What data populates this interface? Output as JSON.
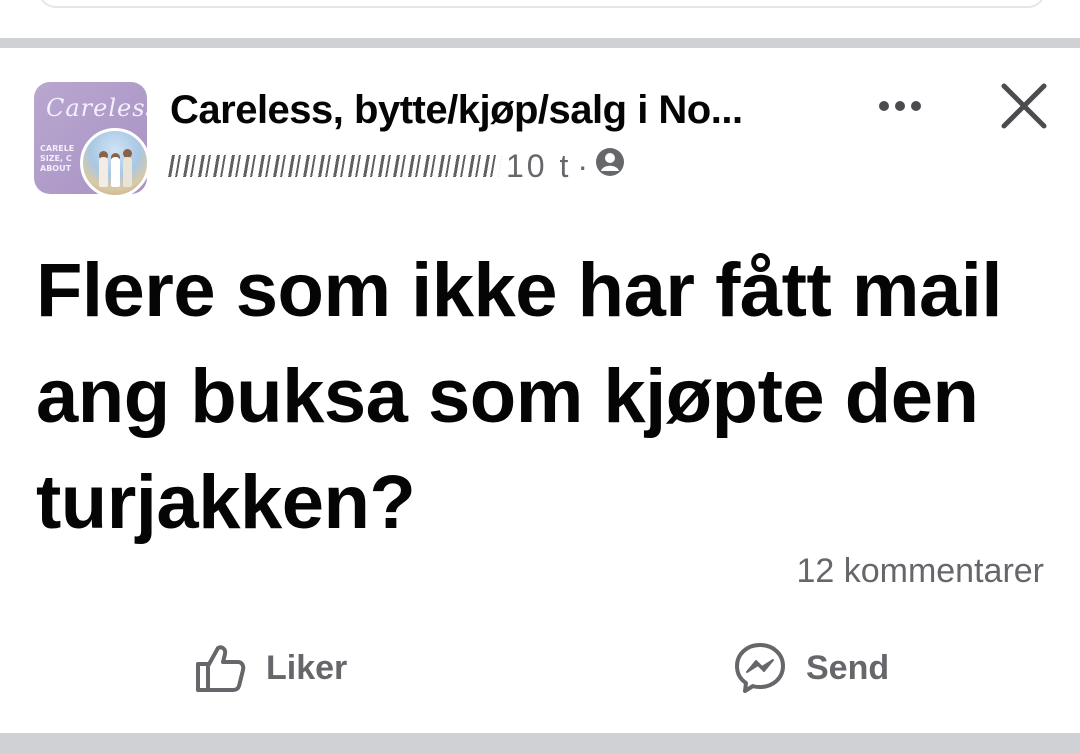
{
  "post": {
    "group_name": "Careless, bytte/kjøp/salg i No...",
    "group_avatar_script": "Careless",
    "group_avatar_lines": [
      "CARELE",
      "SIZE, C",
      "ABOUT"
    ],
    "time": "10 t",
    "separator": "·",
    "body_text": "Flere som ikke har fått mail ang buksa som kjøpte den turjakken?",
    "comments_count": "12 kommentarer"
  },
  "actions": {
    "like_label": "Liker",
    "send_label": "Send"
  },
  "icons": {
    "more": "more-dots-icon",
    "close": "close-icon",
    "privacy": "group-members-icon",
    "like": "thumbs-up-icon",
    "send": "messenger-icon"
  },
  "colors": {
    "text_primary": "#050505",
    "text_secondary": "#65676b",
    "separator": "#cfd1d5",
    "avatar_purple": "#a892c4"
  }
}
